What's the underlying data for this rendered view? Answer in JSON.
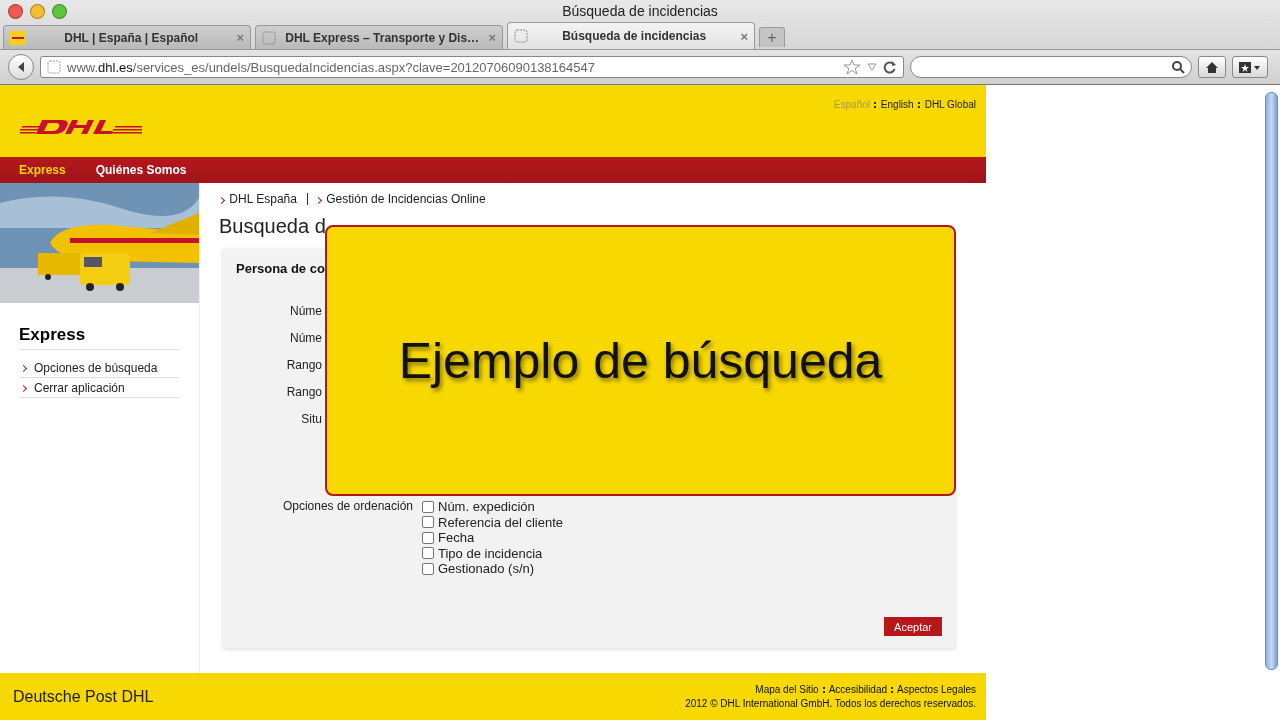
{
  "window": {
    "title": "Búsqueda de incidencias"
  },
  "tabs": [
    {
      "label": "DHL | España | Español",
      "kind": "favicon",
      "close": "×",
      "selected": false
    },
    {
      "label": "DHL Express – Transporte y Dis…",
      "kind": "blank",
      "close": "×",
      "selected": false
    },
    {
      "label": "Búsqueda de incidencias",
      "kind": "blank",
      "close": "×",
      "selected": true
    }
  ],
  "new_tab": "+",
  "address_bar": {
    "url": "www.**dhl.es**/services_es/undels/BusquedaIncidencias.aspx?clave=20120706090138164547"
  },
  "page": {
    "lang_links": [
      {
        "label": "Español",
        "selected": true
      },
      {
        "label": "English",
        "selected": false
      },
      {
        "label": "DHL Global",
        "selected": false
      }
    ],
    "nav": [
      {
        "label": "Express",
        "selected": true
      },
      {
        "label": "Quiénes Somos",
        "selected": false
      }
    ],
    "breadcrumb": [
      "DHL España",
      "Gestión de Incidencias Online"
    ],
    "title": "Busqueda d",
    "sidebar": {
      "heading": "Express",
      "items": [
        "Opciones de búsqueda",
        "Cerrar aplicación"
      ]
    },
    "form": {
      "section_title": "Persona de co",
      "labels": [
        "Núme",
        "Núme",
        "Rango",
        "Rango",
        "Situ"
      ],
      "sort_label": "Opciones de ordenación",
      "sort_options": [
        {
          "label": "Núm. expedición",
          "kind": "checkbox",
          "checked": false
        },
        {
          "label": "Referencia del cliente",
          "kind": "checkbox",
          "checked": false
        },
        {
          "label": "Fecha",
          "kind": "checkbox",
          "checked": false
        },
        {
          "label": "Tipo de incidencia",
          "kind": "checkbox",
          "checked": false
        },
        {
          "label": "Gestionado (s/n)",
          "kind": "checkbox",
          "checked": false
        }
      ],
      "submit": "Aceptar"
    },
    "footer": {
      "brand": "Deutsche Post DHL",
      "links": [
        "Mapa del Sitio",
        "Accesibilidad",
        "Aspectos Legales"
      ],
      "copyright": "2012 © DHL International GmbH. Todos los derechos reservados."
    }
  },
  "overlay": {
    "text": "Ejemplo de búsqueda"
  }
}
